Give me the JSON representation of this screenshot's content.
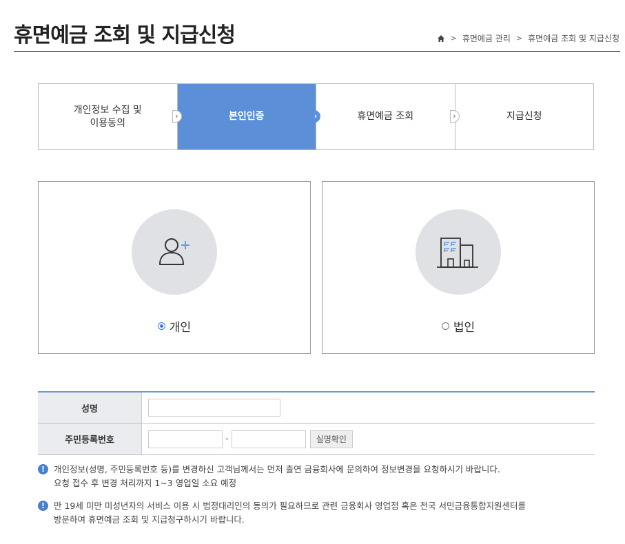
{
  "page": {
    "title": "휴면예금 조회 및 지급신청"
  },
  "breadcrumb": {
    "items": [
      "휴면예금 관리",
      "휴면예금 조회 및 지급신청"
    ]
  },
  "steps": [
    {
      "label": "개인정보 수집 및\n이용동의",
      "active": false
    },
    {
      "label": "본인인증",
      "active": true
    },
    {
      "label": "휴면예금 조회",
      "active": false
    },
    {
      "label": "지급신청",
      "active": false
    }
  ],
  "user_type": {
    "personal": {
      "label": "개인",
      "selected": true,
      "icon": "user-plus-icon"
    },
    "corporate": {
      "label": "법인",
      "selected": false,
      "icon": "building-icon"
    }
  },
  "form": {
    "name_label": "성명",
    "name_value": "",
    "rrn_label": "주민등록번호",
    "rrn_front_value": "",
    "rrn_back_value": "",
    "rrn_separator": "-",
    "verify_button": "실명확인"
  },
  "notices": [
    {
      "line1": "개인정보(성명, 주민등록번호 등)를 변경하신 고객님께서는 먼저 출연 금융회사에 문의하여 정보변경을 요청하시기 바랍니다.",
      "line2": "요청 접수 후 변경 처리까지 1~3 영업일 소요 예정"
    },
    {
      "line1": "만 19세 미만 미성년자의 서비스 이용 시 법정대리인의 동의가 필요하므로 관련 금융회사 영업점 혹은 전국 서민금융통합지원센터를",
      "line2": "방문하여 휴면예금 조회 및 지급청구하시기 바랍니다."
    }
  ],
  "colors": {
    "accent": "#5b8fd8",
    "icon_blue": "#6a9ad6",
    "circle_bg": "#e0e1e4"
  }
}
